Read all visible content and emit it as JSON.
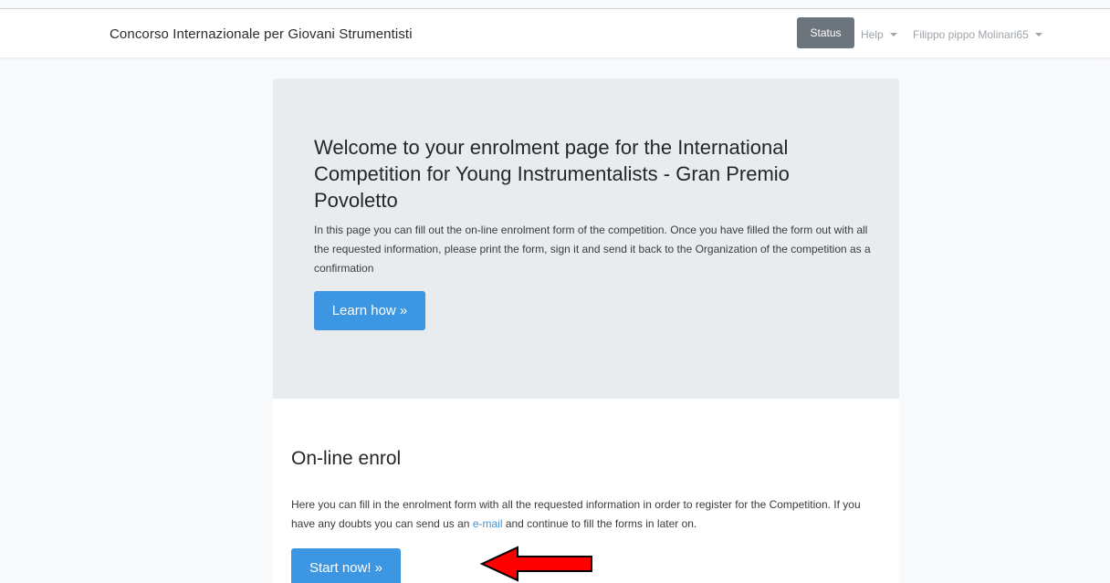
{
  "navbar": {
    "brand": "Concorso Internazionale per Giovani Strumentisti",
    "status_label": "Status",
    "help_label": "Help",
    "user_label": "Filippo pippo Molinari65"
  },
  "jumbotron": {
    "title": "Welcome to your enrolment page for the International Competition for Young Instrumentalists - Gran Premio Povoletto",
    "text": "In this page you can fill out the on-line enrolment form of the competition. Once you have filled the form out with all the requested information, please print the form, sign it and send it back to the Organization of the competition as a confirmation",
    "button_label": "Learn how »"
  },
  "enrol": {
    "title": "On-line enrol",
    "text_before_link": "Here you can fill in the enrolment form with all the requested information in order to register for the Competition. If you have any doubts you can send us an ",
    "link_label": "e-mail",
    "text_after_link": " and continue to fill the forms in later on.",
    "button_label": "Start now! »"
  },
  "colors": {
    "primary": "#3c96e1",
    "status_button": "#6c757d",
    "jumbotron_bg": "#e9ecef",
    "annotation_arrow": "#ff0000"
  }
}
